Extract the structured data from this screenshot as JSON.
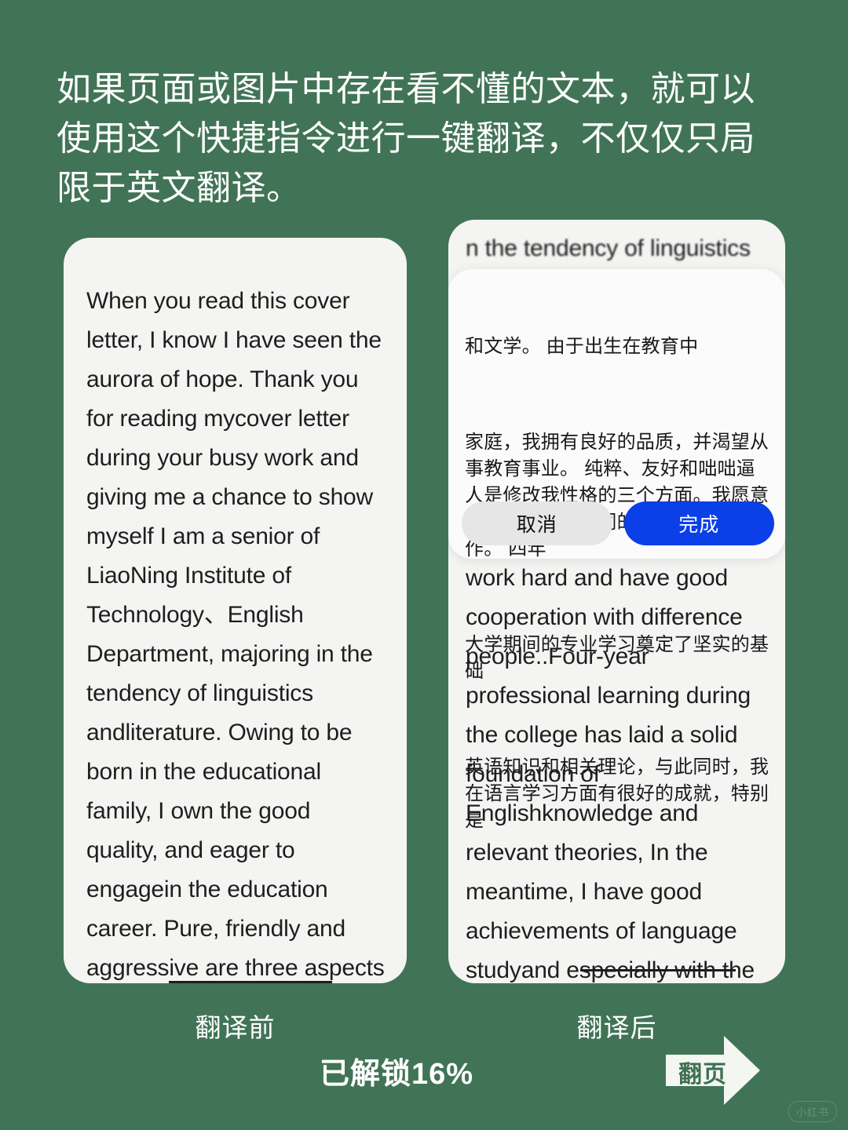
{
  "heading": "如果页面或图片中存在看不懂的文本，就可以使用这个快捷指令进行一键翻译，不仅仅只局限于英文翻译。",
  "theme": {
    "background": "#417456",
    "card": "#f4f5f3",
    "dialog": "#fbfbfb",
    "accent_blue": "#0b3fe8",
    "text_dark": "#1d1f1e",
    "text_white": "#ffffff"
  },
  "left_card": {
    "body": "When you read this cover letter, I know I have seen the aurora of hope. Thank you for reading mycover letter during your busy work and giving me a chance to show myself I am a senior of LiaoNing Institute of Technology、English Department, majoring in the tendency of linguistics andliterature. Owing to be born in the educational family, I own the good quality, and eager to engagein the education career. Pure, friendly and aggressive are three aspects to modify my characters.Iam willing to"
  },
  "right_card": {
    "blurred_top": "n the tendency of linguistics\nandliterature. Owing to be",
    "body_lower": "work hard and have good cooperation with difference people..Four-year professional learning during the college has laid a solid foundation of Englishknowledge and relevant theories, In the meantime, I have good achievements of language studyand especially with the"
  },
  "dialog": {
    "paragraphs": [
      "和文学。 由于出生在教育中",
      "家庭，我拥有良好的品质，并渴望从事教育事业。 纯粹、友好和咄咄逼人是修改我性格的三个方面。我愿意努力工作，与不同的人进行良好的合作。 四年",
      "大学期间的专业学习奠定了坚实的基础",
      "英语知识和相关理论，与此同时，我在语言学习方面有很好的成就，特别是"
    ],
    "cancel_label": "取消",
    "confirm_label": "完成"
  },
  "captions": {
    "before": "翻译前",
    "after": "翻译后"
  },
  "progress": {
    "label": "已解锁16%",
    "percent": 16
  },
  "page_turn": {
    "label": "翻页"
  },
  "watermark": {
    "label": "小红书"
  }
}
